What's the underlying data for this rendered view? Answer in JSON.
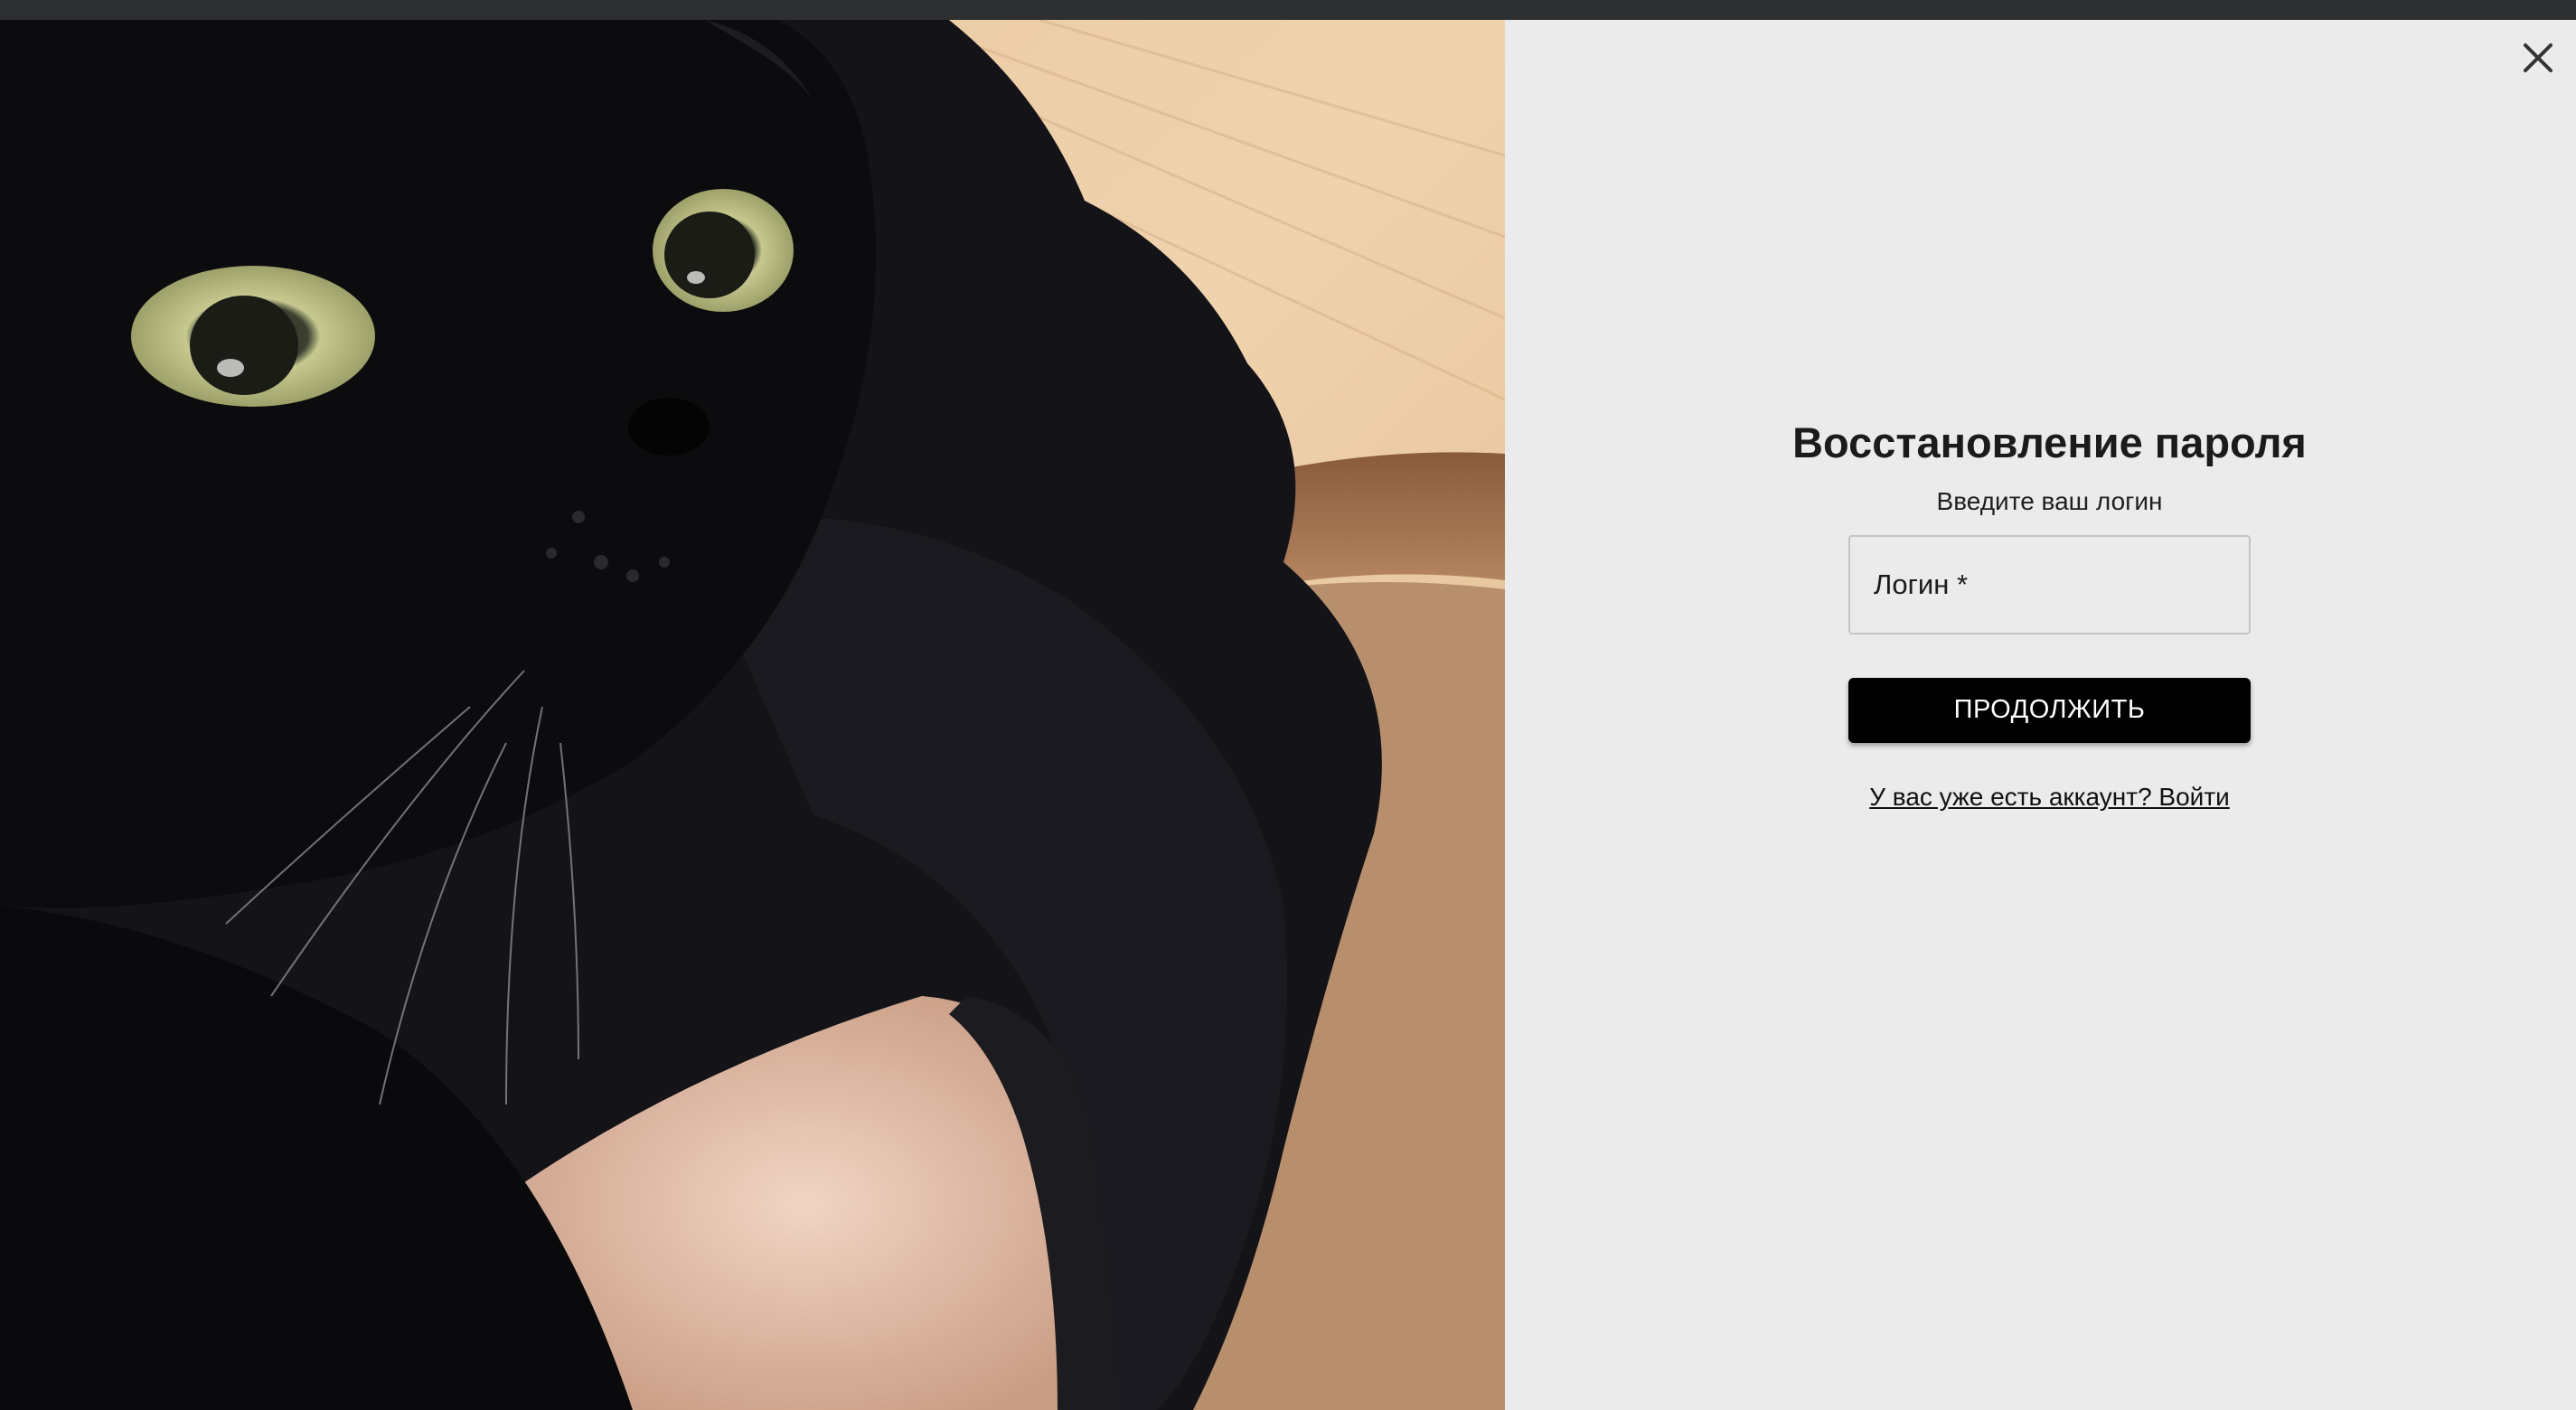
{
  "close_icon": "close-icon",
  "photo": {
    "subject": "cat-photo"
  },
  "form": {
    "title": "Восстановление пароля",
    "subtitle": "Введите ваш логин",
    "login_placeholder": "Логин *",
    "login_value": "",
    "continue_label": "ПРОДОЛЖИТЬ",
    "login_link": "У вас уже есть аккаунт? Войти"
  },
  "colors": {
    "panel_background": "#ebebeb",
    "button_background": "#000000",
    "button_text": "#ffffff",
    "field_border": "#c4c4c4",
    "top_strip": "#2d2f31"
  }
}
